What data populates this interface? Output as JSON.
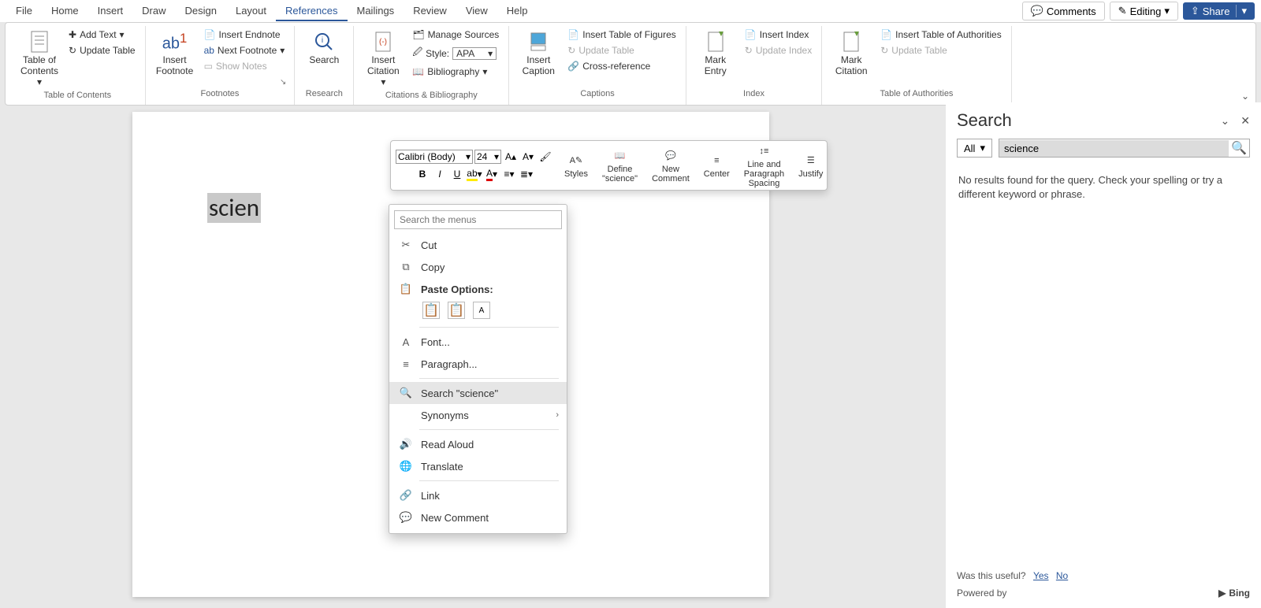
{
  "menu": {
    "items": [
      "File",
      "Home",
      "Insert",
      "Draw",
      "Design",
      "Layout",
      "References",
      "Mailings",
      "Review",
      "View",
      "Help"
    ],
    "active_index": 6
  },
  "top_buttons": {
    "comments": "Comments",
    "editing": "Editing",
    "share": "Share"
  },
  "ribbon": {
    "groups": [
      {
        "label": "Table of Contents",
        "big": "Table of\nContents",
        "small": [
          "Add Text",
          "Update Table"
        ]
      },
      {
        "label": "Footnotes",
        "big": "Insert\nFootnote",
        "small": [
          "Insert Endnote",
          "Next Footnote",
          "Show Notes"
        ]
      },
      {
        "label": "Research",
        "big": "Search"
      },
      {
        "label": "Citations & Bibliography",
        "big": "Insert\nCitation",
        "small": [
          "Manage Sources",
          "Style:",
          "Bibliography"
        ],
        "style_value": "APA"
      },
      {
        "label": "Captions",
        "big": "Insert\nCaption",
        "small": [
          "Insert Table of Figures",
          "Update Table",
          "Cross-reference"
        ]
      },
      {
        "label": "Index",
        "big": "Mark\nEntry",
        "small": [
          "Insert Index",
          "Update Index"
        ]
      },
      {
        "label": "Table of Authorities",
        "big": "Mark\nCitation",
        "small": [
          "Insert Table of Authorities",
          "Update Table"
        ]
      }
    ]
  },
  "document": {
    "selected_text": "scien"
  },
  "mini_toolbar": {
    "font": "Calibri (Body)",
    "size": "24",
    "buttons": {
      "styles": "Styles",
      "define": "Define\n\"science\"",
      "new_comment": "New\nComment",
      "center": "Center",
      "spacing": "Line and\nParagraph Spacing",
      "justify": "Justify"
    }
  },
  "context_menu": {
    "search_placeholder": "Search the menus",
    "items": {
      "cut": "Cut",
      "copy": "Copy",
      "paste": "Paste Options:",
      "font": "Font...",
      "paragraph": "Paragraph...",
      "search": "Search \"science\"",
      "synonyms": "Synonyms",
      "read": "Read Aloud",
      "translate": "Translate",
      "link": "Link",
      "new_comment": "New Comment"
    }
  },
  "search_pane": {
    "title": "Search",
    "scope": "All",
    "query": "science",
    "message": "No results found for the query. Check your spelling or try a different keyword or phrase.",
    "useful_prompt": "Was this useful?",
    "yes": "Yes",
    "no": "No",
    "powered": "Powered by",
    "bing": "Bing"
  }
}
